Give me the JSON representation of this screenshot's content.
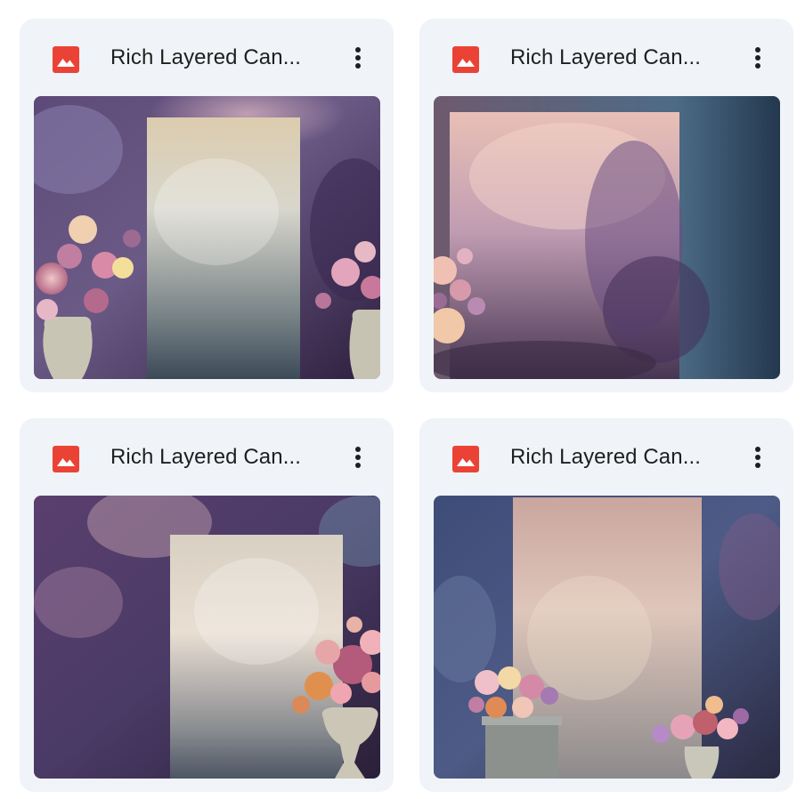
{
  "files": [
    {
      "title": "Rich Layered Can...",
      "icon": "image-file-icon",
      "menu_icon": "more-vert-icon"
    },
    {
      "title": "Rich Layered Can...",
      "icon": "image-file-icon",
      "menu_icon": "more-vert-icon"
    },
    {
      "title": "Rich Layered Can...",
      "icon": "image-file-icon",
      "menu_icon": "more-vert-icon"
    },
    {
      "title": "Rich Layered Can...",
      "icon": "image-file-icon",
      "menu_icon": "more-vert-icon"
    }
  ],
  "colors": {
    "card_bg": "#f0f4f9",
    "icon_red": "#ea4335",
    "text": "#1f1f1f"
  }
}
